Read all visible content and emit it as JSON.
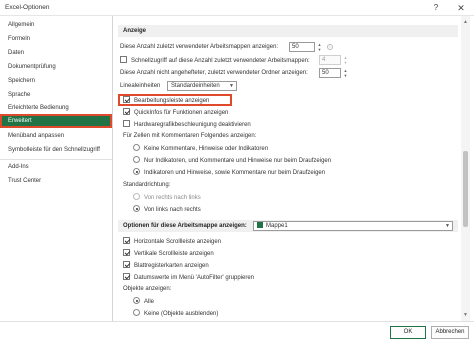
{
  "window": {
    "title": "Excel-Optionen",
    "help_glyph": "?",
    "close_glyph": "✕"
  },
  "sidebar": {
    "items": [
      {
        "label": "Allgemein"
      },
      {
        "label": "Formeln"
      },
      {
        "label": "Daten"
      },
      {
        "label": "Dokumentprüfung"
      },
      {
        "label": "Speichern"
      },
      {
        "label": "Sprache"
      },
      {
        "label": "Erleichterte Bedienung"
      },
      {
        "label": "Erweitert",
        "selected": true
      },
      {
        "label": "Menüband anpassen"
      },
      {
        "label": "Symbolleiste für den Schnellzugriff"
      },
      {
        "label": "Add-Ins"
      },
      {
        "label": "Trust Center"
      }
    ]
  },
  "anzeige": {
    "header": "Anzeige",
    "recent_workbooks_label": "Diese Anzahl zuletzt verwendeter Arbeitsmappen anzeigen:",
    "recent_workbooks_value": "50",
    "quick_access_label": "Schnellzugriff auf diese Anzahl zuletzt verwendeter Arbeitsmappen:",
    "quick_access_checked": false,
    "quick_access_value": "4",
    "unpinned_folders_label": "Diese Anzahl nicht angehefteter, zuletzt verwendeter Ordner anzeigen:",
    "unpinned_folders_value": "50",
    "ruler_units_label": "Linealeinheiten",
    "ruler_units_value": "Standardeinheiten",
    "formula_bar_label": "Bearbeitungsleiste anzeigen",
    "formula_bar_checked": true,
    "quickinfo_label": "QuickInfos für Funktionen anzeigen",
    "quickinfo_checked": true,
    "hw_accel_label": "Hardwaregrafikbeschleunigung deaktivieren",
    "hw_accel_checked": false,
    "comments_label": "Für Zellen mit Kommentaren Folgendes anzeigen:",
    "comments_options": [
      {
        "label": "Keine Kommentare, Hinweise oder Indikatoren",
        "checked": false
      },
      {
        "label": "Nur Indikatoren, und Kommentare und Hinweise nur beim Draufzeigen",
        "checked": false
      },
      {
        "label": "Indikatoren und Hinweise, sowie Kommentare nur beim Draufzeigen",
        "checked": true
      }
    ],
    "direction_label": "Standardrichtung:",
    "direction_options": [
      {
        "label": "Von rechts nach links",
        "checked": false
      },
      {
        "label": "Von links nach rechts",
        "checked": true
      }
    ]
  },
  "workbook": {
    "header": "Optionen für diese Arbeitsmappe anzeigen:",
    "selected_workbook": "Mappe1",
    "options": [
      {
        "label": "Horizontale Scrollleiste anzeigen",
        "checked": true
      },
      {
        "label": "Vertikale Scrollleiste anzeigen",
        "checked": true
      },
      {
        "label": "Blattregisterkarten anzeigen",
        "checked": true
      },
      {
        "label": "Datumswerte im Menü 'AutoFilter' gruppieren",
        "checked": true
      }
    ],
    "objects_label": "Objekte anzeigen:",
    "objects_options": [
      {
        "label": "Alle",
        "checked": true
      },
      {
        "label": "Keine (Objekte ausblenden)",
        "checked": false
      }
    ]
  },
  "footer": {
    "ok_label": "OK",
    "cancel_label": "Abbrechen"
  },
  "colors": {
    "accent": "#217346",
    "highlight": "#e04a2c"
  }
}
